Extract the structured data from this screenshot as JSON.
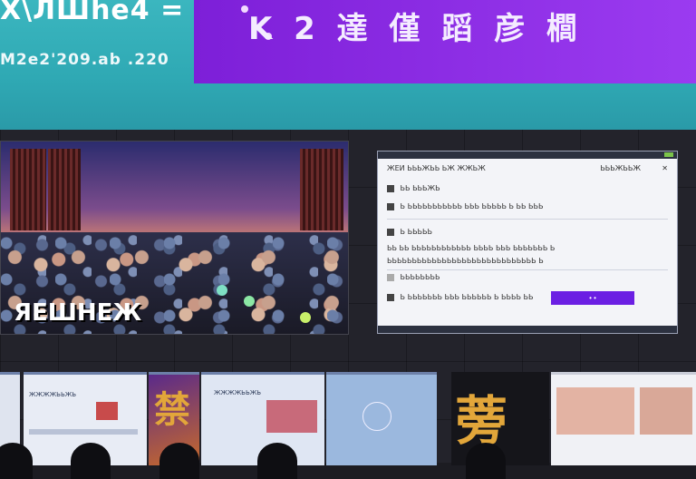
{
  "banner": {
    "title": "X\\ЛШhe4 =",
    "subtitle": "M2e2'209.ab .220",
    "headline": "K 2 達 僅 蹈 彦 櫚"
  },
  "left_screen": {
    "caption": "ЯЕШНЕЖ"
  },
  "panel": {
    "top_label": "ЖЕИ ЬЬЬЖЬЬ ЬЖ ЖЖЬЖ",
    "top_right_label": "ЬЬЬЖЬЬЖ",
    "row1": "ЬЬ ЬЬЬЖЬ",
    "row2": "Ь ЬЬЬЬЬЬЬЬЬЬЬ ЬЬЬ ЬЬЬЬЬ Ь ЬЬ ЬЬЬ",
    "row3a": "Ь ЬЬЬЬЬ",
    "row4": "ЬЬ ЬЬ ЬЬЬЬЬЬЬЬЬЬЬЬ ЬЬЬЬ ЬЬЬ ЬЬЬЬЬЬЬ Ь",
    "row5": "ЬЬЬЬЬЬЬЬЬЬЬЬЬЬЬЬЬЬЬЬЬЬЬЬЬЬЬЬЬЬ Ь",
    "row6": "ЬЬЬЬЬЬЬЬ",
    "row7": "Ь ЬЬЬЬЬЬЬ ЬЬЬ ЬЬЬЬЬЬ Ь ЬЬЬЬ ЬЬ",
    "submit_label": "• •"
  },
  "thumbnails": {
    "t1_title": "ЖЖЖЖЬЬЖЬ",
    "t2_title": "ЖЖЖЖЬЬЖЬ",
    "t3_glyph": "禁",
    "t4_glyph": "蒡"
  },
  "colors": {
    "banner_teal": "#3bb6bf",
    "headline_purple": "#8a2be2",
    "button_purple": "#6b1fe3"
  },
  "icons": [
    "window-controls-icon",
    "close-icon",
    "sidebar-item-icon"
  ]
}
